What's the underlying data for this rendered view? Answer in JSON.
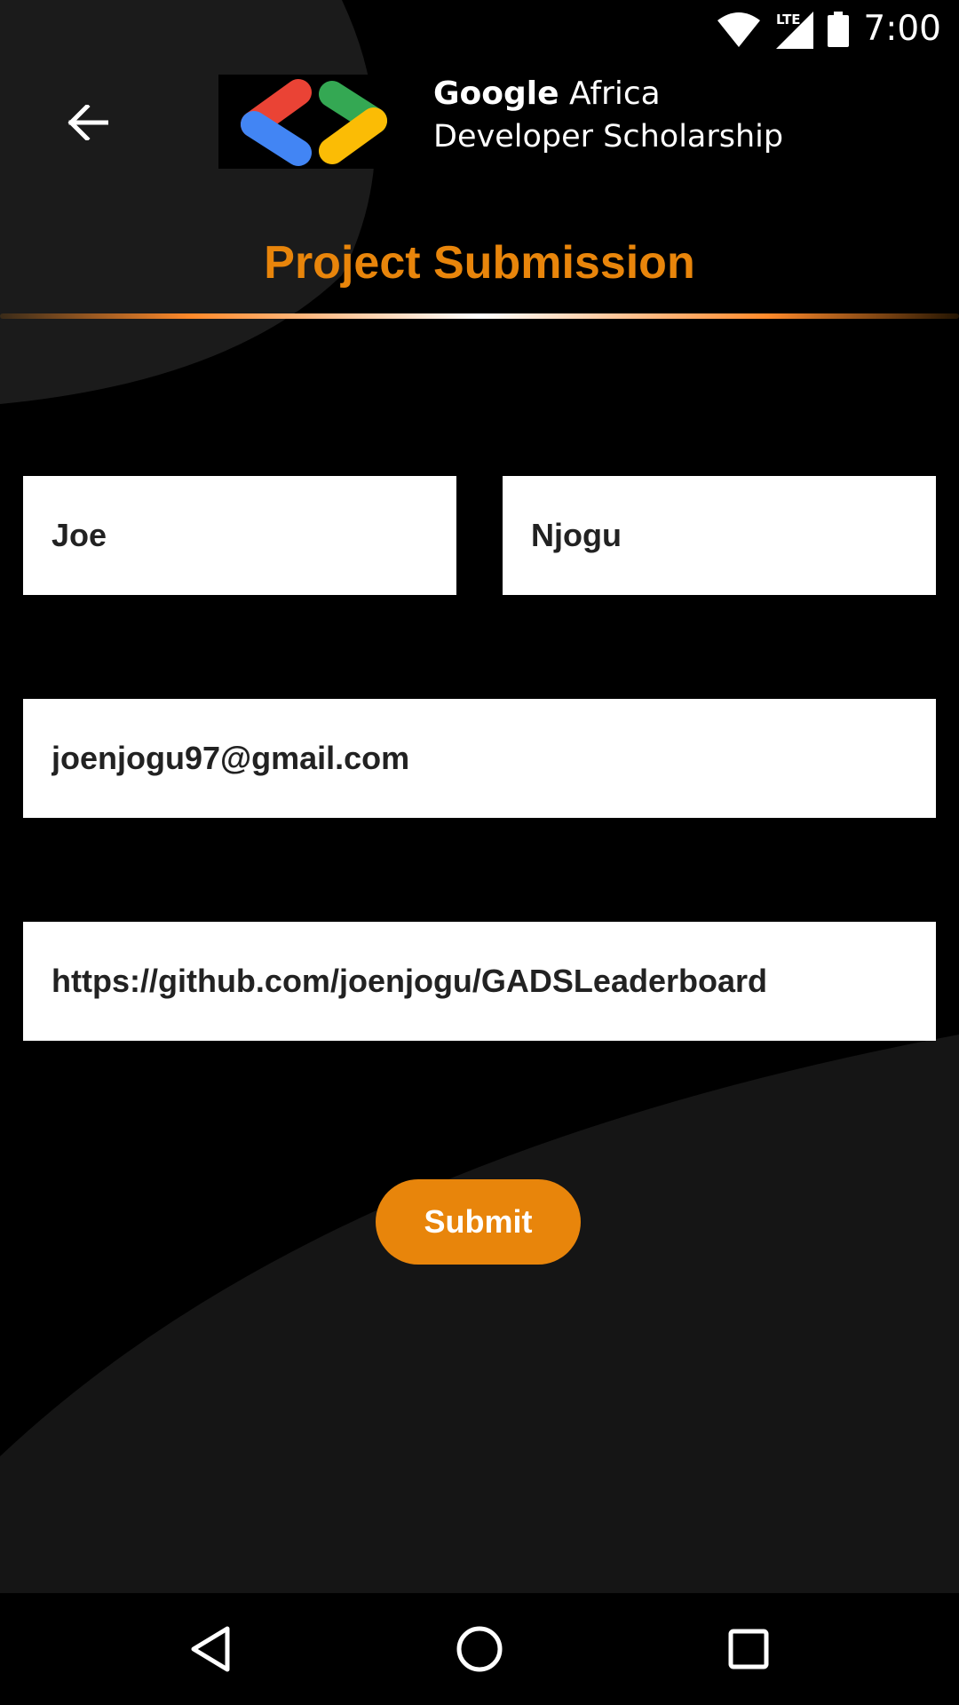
{
  "status_bar": {
    "time": "7:00",
    "icons": [
      "wifi-icon",
      "lte-signal-icon",
      "battery-icon"
    ],
    "lte_label": "LTE"
  },
  "header": {
    "back_icon": "arrow-left-icon",
    "brand_bold": "Google",
    "brand_rest": "Africa",
    "brand_line2": "Developer Scholarship",
    "logo_colors": {
      "red": "#EA4335",
      "blue": "#4285F4",
      "green": "#34A853",
      "yellow": "#FBBC05"
    }
  },
  "page": {
    "title": "Project Submission",
    "accent_color": "#E8850B"
  },
  "form": {
    "first_name": "Joe",
    "last_name": "Njogu",
    "email": "joenjogu97@gmail.com",
    "github_link": "https://github.com/joenjogu/GADSLeaderboard",
    "submit_label": "Submit"
  },
  "nav_bar": {
    "icons": [
      "nav-back-icon",
      "nav-home-icon",
      "nav-recents-icon"
    ]
  }
}
